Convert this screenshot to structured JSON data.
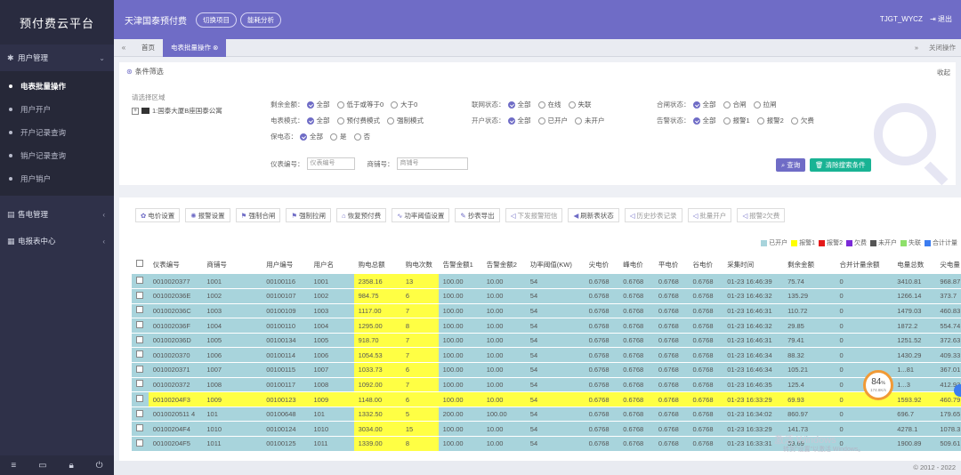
{
  "brand": "预付费云平台",
  "sidebar": {
    "group_user": "用户管理",
    "items": [
      "电表批量操作",
      "用户开户",
      "开户记录查询",
      "销户记录查询",
      "用户销户"
    ],
    "group_sales": "售电管理",
    "group_report": "电报表中心"
  },
  "header": {
    "org": "天津国泰预付费",
    "switch_project": "切换项目",
    "energy_analysis": "能耗分析",
    "user": "TJGT_WYCZ",
    "logout": "退出"
  },
  "tabs": {
    "home": "首页",
    "active": "电表批量操作",
    "close_ops": "关闭操作"
  },
  "filter": {
    "title": "条件筛选",
    "collapse": "收起",
    "tree_title": "请选择区域",
    "tree_node": "1:国泰大厦B座国泰公寓",
    "row1": {
      "remain_label": "剩余金额：",
      "remain_opts": [
        "全部",
        "低于或等于0",
        "大于0"
      ],
      "link_label": "联网状态：",
      "link_opts": [
        "全部",
        "在线",
        "失联"
      ],
      "gate_label": "合闸状态：",
      "gate_opts": [
        "全部",
        "合闸",
        "拉闸"
      ]
    },
    "row2": {
      "mode_label": "电表模式：",
      "mode_opts": [
        "全部",
        "预付费模式",
        "强制模式"
      ],
      "open_label": "开户状态：",
      "open_opts": [
        "全部",
        "已开户",
        "未开户"
      ],
      "alarm_label": "告警状态：",
      "alarm_opts": [
        "全部",
        "报警1",
        "报警2",
        "欠费"
      ]
    },
    "row3": {
      "protect_label": "保电态：",
      "protect_opts": [
        "全部",
        "是",
        "否"
      ]
    },
    "meter_label": "仪表编号：",
    "meter_placeholder": "仪表编号",
    "shop_label": "商铺号：",
    "shop_placeholder": "商铺号",
    "query": "查询",
    "clear": "清除搜索条件"
  },
  "toolbar": [
    "电价设置",
    "报警设置",
    "强制合闸",
    "强制拉闸",
    "恢复预付费",
    "功率阈值设置",
    "抄表导出",
    "下发报警短信",
    "刷新表状态",
    "历史抄表记录",
    "批量开户",
    "报警2欠费"
  ],
  "legend": [
    "已开户",
    "报警1",
    "报警2",
    "欠费",
    "未开户",
    "失联",
    "合计计量"
  ],
  "colors": {
    "brand_purple": "#6f6cc6",
    "row_blue": "#a8d4dc",
    "row_yellow": "#ffff44",
    "legend": [
      "#a8d4dc",
      "#ffff00",
      "#e51a1a",
      "#7b2bd8",
      "#555555",
      "#8ee06b",
      "#3c7df0"
    ]
  },
  "table": {
    "headers": [
      "仪表编号",
      "商铺号",
      "用户编号",
      "用户名",
      "购电总额",
      "购电次数",
      "告警金额1",
      "告警金额2",
      "功率阈值(KW)",
      "尖电价",
      "峰电价",
      "平电价",
      "谷电价",
      "采集时间",
      "剩余金额",
      "合并计量余额",
      "电量总数",
      "尖电量"
    ],
    "rows": [
      {
        "y": false,
        "c": [
          "0010020377",
          "1001",
          "00100116",
          "1001",
          "2358.16",
          "13",
          "100.00",
          "10.00",
          "54",
          "0.6768",
          "0.6768",
          "0.6768",
          "0.6768",
          "01-23 16:46:39",
          "75.74",
          "0",
          "3410.81",
          "968.87"
        ]
      },
      {
        "y": false,
        "c": [
          "001002036E",
          "1002",
          "00100107",
          "1002",
          "984.75",
          "6",
          "100.00",
          "10.00",
          "54",
          "0.6768",
          "0.6768",
          "0.6768",
          "0.6768",
          "01-23 16:46:32",
          "135.29",
          "0",
          "1266.14",
          "373.7"
        ]
      },
      {
        "y": false,
        "c": [
          "001002036C",
          "1003",
          "00100109",
          "1003",
          "1117.00",
          "7",
          "100.00",
          "10.00",
          "54",
          "0.6768",
          "0.6768",
          "0.6768",
          "0.6768",
          "01-23 16:46:31",
          "110.72",
          "0",
          "1479.03",
          "460.83"
        ]
      },
      {
        "y": false,
        "c": [
          "001002036F",
          "1004",
          "00100110",
          "1004",
          "1295.00",
          "8",
          "100.00",
          "10.00",
          "54",
          "0.6768",
          "0.6768",
          "0.6768",
          "0.6768",
          "01-23 16:46:32",
          "29.85",
          "0",
          "1872.2",
          "554.74"
        ]
      },
      {
        "y": false,
        "c": [
          "001002036D",
          "1005",
          "00100134",
          "1005",
          "918.70",
          "7",
          "100.00",
          "10.00",
          "54",
          "0.6768",
          "0.6768",
          "0.6768",
          "0.6768",
          "01-23 16:46:31",
          "79.41",
          "0",
          "1251.52",
          "372.63"
        ]
      },
      {
        "y": false,
        "c": [
          "0010020370",
          "1006",
          "00100114",
          "1006",
          "1054.53",
          "7",
          "100.00",
          "10.00",
          "54",
          "0.6768",
          "0.6768",
          "0.6768",
          "0.6768",
          "01-23 16:46:34",
          "88.32",
          "0",
          "1430.29",
          "409.33"
        ]
      },
      {
        "y": false,
        "c": [
          "0010020371",
          "1007",
          "00100115",
          "1007",
          "1033.73",
          "6",
          "100.00",
          "10.00",
          "54",
          "0.6768",
          "0.6768",
          "0.6768",
          "0.6768",
          "01-23 16:46:34",
          "105.21",
          "0",
          "1...81",
          "367.01"
        ]
      },
      {
        "y": false,
        "c": [
          "0010020372",
          "1008",
          "00100117",
          "1008",
          "1092.00",
          "7",
          "100.00",
          "10.00",
          "54",
          "0.6768",
          "0.6768",
          "0.6768",
          "0.6768",
          "01-23 16:46:35",
          "125.4",
          "0",
          "1...3",
          "412.93"
        ]
      },
      {
        "y": true,
        "c": [
          "00100204F3",
          "1009",
          "00100123",
          "1009",
          "1148.00",
          "6",
          "100.00",
          "10.00",
          "54",
          "0.6768",
          "0.6768",
          "0.6768",
          "0.6768",
          "01-23 16:33:29",
          "69.93",
          "0",
          "1593.92",
          "460.79"
        ]
      },
      {
        "y": false,
        "c": [
          "0010020511 4",
          "101",
          "00100648",
          "101",
          "1332.50",
          "5",
          "200.00",
          "100.00",
          "54",
          "0.6768",
          "0.6768",
          "0.6768",
          "0.6768",
          "01-23 16:34:02",
          "860.97",
          "0",
          "696.7",
          "179.65"
        ]
      },
      {
        "y": false,
        "c": [
          "00100204F4",
          "1010",
          "00100124",
          "1010",
          "3034.00",
          "15",
          "100.00",
          "10.00",
          "54",
          "0.6768",
          "0.6768",
          "0.6768",
          "0.6768",
          "01-23 16:33:29",
          "141.73",
          "0",
          "4278.1",
          "1078.3"
        ]
      },
      {
        "y": false,
        "c": [
          "00100204F5",
          "1011",
          "00100125",
          "1011",
          "1339.00",
          "8",
          "100.00",
          "10.00",
          "54",
          "0.6768",
          "0.6768",
          "0.6768",
          "0.6768",
          "01-23 16:33:31",
          "59.69",
          "0",
          "1900.89",
          "509.61"
        ]
      }
    ]
  },
  "gauge": {
    "percent": "84",
    "unit": "%",
    "rate": "174.8K/s"
  },
  "watermark": {
    "line1": "激活 Windows",
    "line2": "转到\"设置\"以激活 Windows。"
  },
  "footer": "© 2012 - 2022"
}
